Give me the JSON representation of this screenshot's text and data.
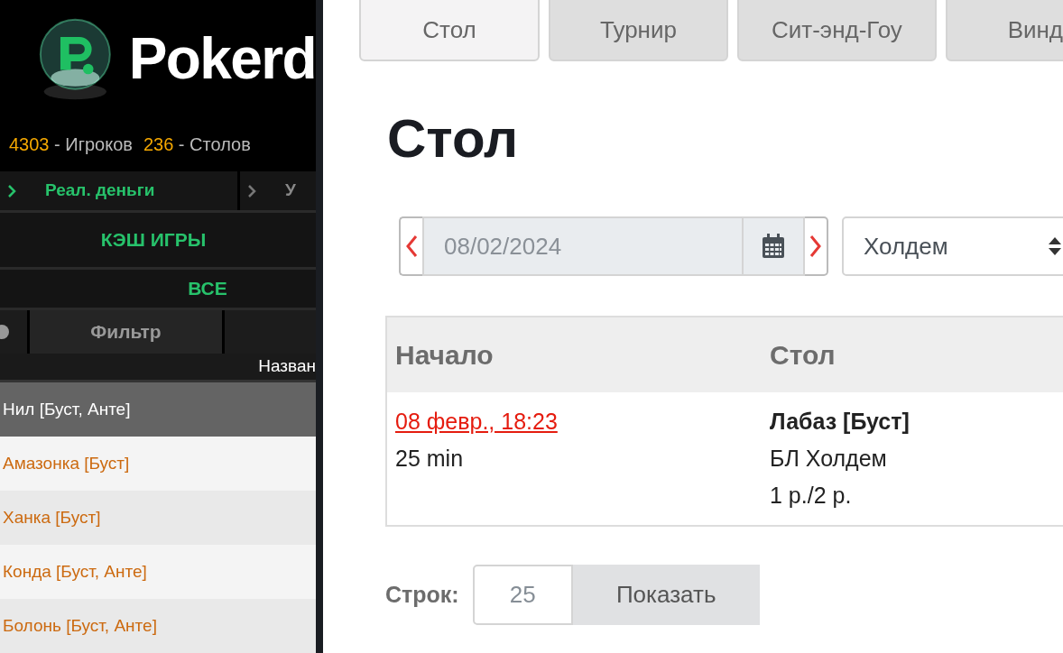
{
  "lobby": {
    "logo_text": "Pokerd",
    "stats": [
      {
        "count": "4303",
        "label": "- Игроков"
      },
      {
        "count": "236",
        "label": "- Столов"
      }
    ],
    "money_tabs": [
      {
        "label": "Реал. деньги",
        "selected": true
      },
      {
        "label": "У",
        "selected": false
      }
    ],
    "section": "КЭШ ИГРЫ",
    "subsection": "ВСЕ",
    "filter_button": "Фильтр",
    "column_header": "Назван",
    "tables": [
      {
        "name": "Нил [Буст, Анте]",
        "selected": true
      },
      {
        "name": "Амазонка [Буст]",
        "selected": false
      },
      {
        "name": "Ханка [Буст]",
        "selected": false
      },
      {
        "name": "Конда [Буст, Анте]",
        "selected": false
      },
      {
        "name": "Болонь [Буст, Анте]",
        "selected": false
      }
    ]
  },
  "tabs": [
    {
      "label": "Стол",
      "selected": true
    },
    {
      "label": "Турнир",
      "selected": false
    },
    {
      "label": "Сит-энд-Гоу",
      "selected": false
    },
    {
      "label": "Винд",
      "selected": false
    }
  ],
  "heading": "Стол",
  "date_field": {
    "value": "08/02/2024"
  },
  "game_select": {
    "value": "Холдем"
  },
  "table": {
    "columns": [
      "Начало",
      "Стол"
    ],
    "rows": [
      {
        "start": "08 февр., 18:23",
        "duration": "25 min",
        "table_name": "Лабаз [Буст]",
        "game": "БЛ Холдем",
        "stakes": "1 р./2 р."
      }
    ]
  },
  "rows_control": {
    "label": "Строк:",
    "value": "25",
    "button": "Показать"
  }
}
